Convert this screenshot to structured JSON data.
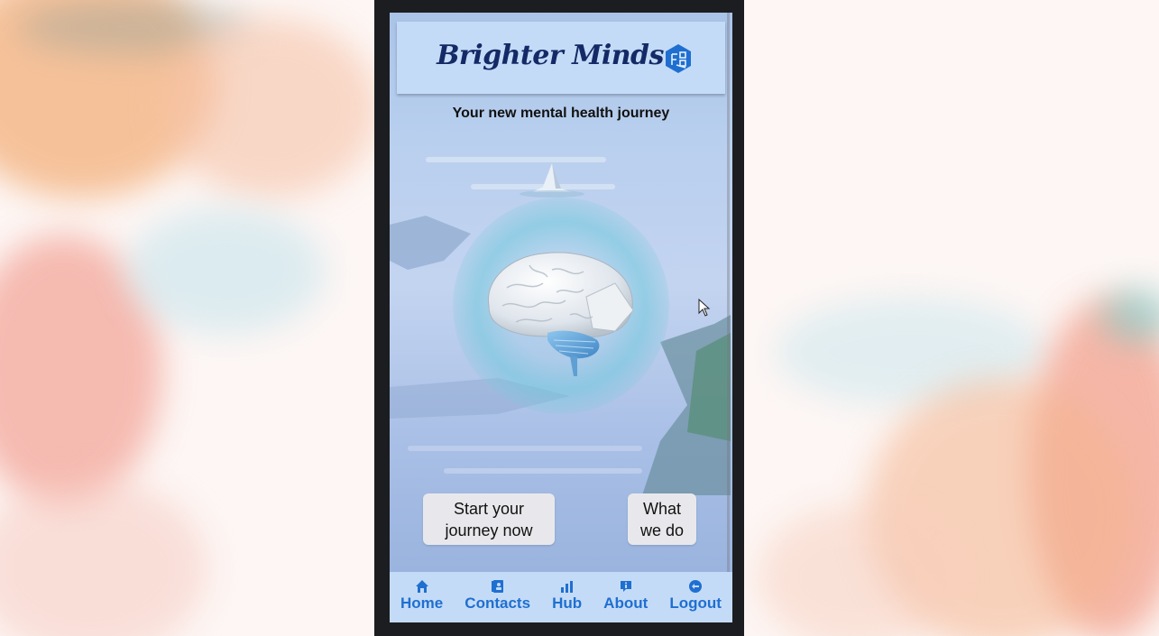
{
  "app": {
    "brand_name": "Brighter Minds",
    "tagline": "Your new mental health journey"
  },
  "actions": {
    "start_line1": "Start your",
    "start_line2": "journey now",
    "what_line1": "What",
    "what_line2": "we do"
  },
  "nav": {
    "items": [
      {
        "label": "Home",
        "icon": "home-icon"
      },
      {
        "label": "Contacts",
        "icon": "contacts-icon"
      },
      {
        "label": "Hub",
        "icon": "bar-chart-icon"
      },
      {
        "label": "About",
        "icon": "info-icon"
      },
      {
        "label": "Logout",
        "icon": "logout-icon"
      }
    ]
  },
  "colors": {
    "brand_text": "#142a66",
    "header_bg": "#c4dbf7",
    "nav_accent": "#1f6fd0",
    "button_bg": "#e8e8ec"
  }
}
